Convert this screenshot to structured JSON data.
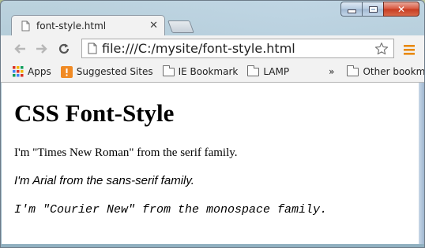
{
  "browser": {
    "tab": {
      "title": "font-style.html"
    },
    "address": {
      "url": "file:///C:/mysite/font-style.html"
    },
    "bookmarks": {
      "apps_label": "Apps",
      "items": [
        {
          "label": "Suggested Sites"
        },
        {
          "label": "IE Bookmark"
        },
        {
          "label": "LAMP"
        }
      ],
      "overflow_label": "»",
      "other_label": "Other bookmarks"
    }
  },
  "page": {
    "heading": "CSS Font-Style",
    "serif_text": "I'm \"Times New Roman\" from the serif family.",
    "sans_text": "I'm Arial from the sans-serif family.",
    "mono_text": "I'm \"Courier New\" from the monospace family."
  },
  "colors": {
    "menu_accent": "#e8890c",
    "suggested_sites_icon": "#f08a24"
  },
  "icons": {
    "tab_page": "page-icon",
    "back": "back-arrow-icon",
    "forward": "forward-arrow-icon",
    "reload": "reload-icon",
    "file": "page-icon",
    "bookmark_star": "star-icon",
    "menu": "hamburger-menu-icon",
    "apps": "apps-grid-icon",
    "folder": "folder-icon"
  }
}
